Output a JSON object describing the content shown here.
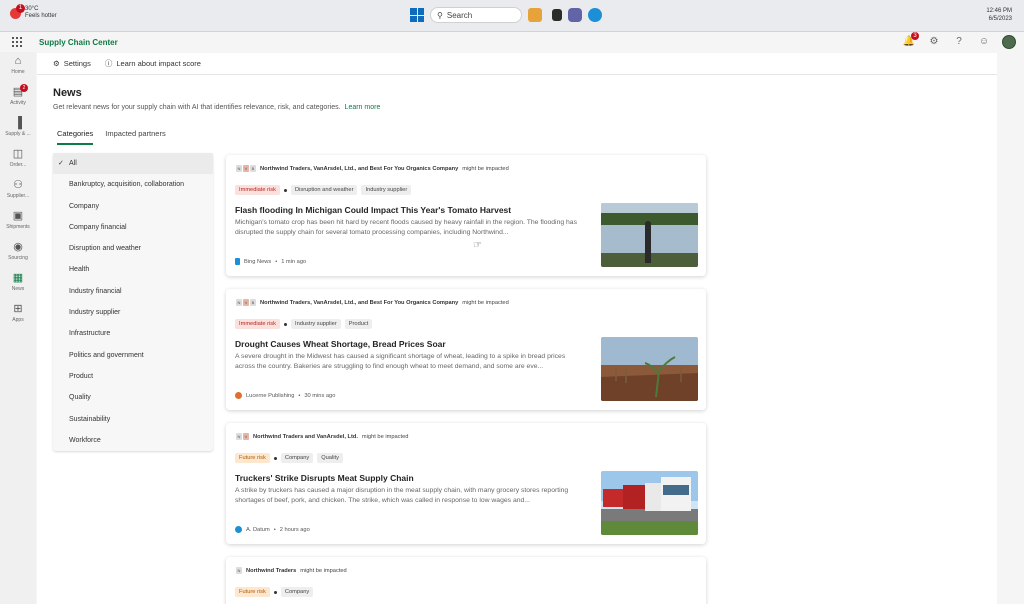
{
  "taskbar": {
    "weather_temp": "30°C",
    "weather_desc": "Feels hotter",
    "weather_badge": "1",
    "search_label": "Search",
    "time": "12:46 PM",
    "date": "6/5/2023"
  },
  "app": {
    "title": "Supply Chain Center",
    "notification_count": "3"
  },
  "rail": [
    {
      "label": "Home",
      "icon": "home-icon",
      "badge": ""
    },
    {
      "label": "Activity",
      "icon": "activity-icon",
      "badge": "2"
    },
    {
      "label": "Supply & ...",
      "icon": "supply-icon",
      "badge": ""
    },
    {
      "label": "Order...",
      "icon": "order-icon",
      "badge": ""
    },
    {
      "label": "Supplier...",
      "icon": "supplier-icon",
      "badge": ""
    },
    {
      "label": "Shipments",
      "icon": "shipments-icon",
      "badge": ""
    },
    {
      "label": "Sourcing",
      "icon": "sourcing-icon",
      "badge": ""
    },
    {
      "label": "News",
      "icon": "news-icon",
      "badge": ""
    },
    {
      "label": "Apps",
      "icon": "apps-icon",
      "badge": ""
    }
  ],
  "toolbar": {
    "settings_label": "Settings",
    "learn_label": "Learn about impact score"
  },
  "page": {
    "title": "News",
    "description": "Get relevant news for your supply chain with AI that identifies relevance, risk, and categories.",
    "learn_more": "Learn more"
  },
  "tabs": [
    {
      "label": "Categories",
      "active": true
    },
    {
      "label": "Impacted partners",
      "active": false
    }
  ],
  "categories": [
    "All",
    "Bankruptcy, acquisition, collaboration",
    "Company",
    "Company financial",
    "Disruption and weather",
    "Health",
    "Industry financial",
    "Industry supplier",
    "Infrastructure",
    "Politics and government",
    "Product",
    "Quality",
    "Sustainability",
    "Workforce"
  ],
  "articles": [
    {
      "partners": "Northwind Traders, VanArsdel, Ltd., and Best For You Organics Company",
      "impact_suffix": "might be impacted",
      "risk": "Immediate risk",
      "tags": [
        "Disruption and weather",
        "Industry supplier"
      ],
      "headline": "Flash flooding In Michigan Could Impact This Year's Tomato Harvest",
      "summary": "Michigan's tomato crop has been hit hard by recent floods caused by heavy rainfall in the region. The flooding has disrupted the supply chain for several tomato processing companies, including Northwind...",
      "source": "Bing News",
      "time": "1 min ago"
    },
    {
      "partners": "Northwind Traders, VanArsdel, Ltd., and Best For You Organics Company",
      "impact_suffix": "might be impacted",
      "risk": "Immediate risk",
      "tags": [
        "Industry supplier",
        "Product"
      ],
      "headline": "Drought Causes Wheat Shortage, Bread Prices Soar",
      "summary": "A severe drought in the Midwest has caused a significant shortage of wheat, leading to a spike in bread prices across the country. Bakeries are struggling to find enough wheat to meet demand, and some are eve...",
      "source": "Lucerne Publishing",
      "time": "30 mins ago"
    },
    {
      "partners": "Northwind Traders and VanArsdel, Ltd.",
      "impact_suffix": "might be impacted",
      "risk": "Future risk",
      "tags": [
        "Company",
        "Quality"
      ],
      "headline": "Truckers' Strike Disrupts Meat Supply Chain",
      "summary": "A strike by truckers has caused a major disruption in the meat supply chain, with many grocery stores reporting shortages of beef, pork, and chicken. The strike, which was called in response to low wages and...",
      "source": "A. Datum",
      "time": "2 hours ago"
    },
    {
      "partners": "Northwind Traders",
      "impact_suffix": "might be impacted",
      "risk": "Future risk",
      "tags": [
        "Company"
      ],
      "headline": "",
      "summary": "",
      "source": "",
      "time": ""
    }
  ],
  "colors": {
    "accent": "#0e7a45",
    "immediate_risk": "#b3261e",
    "future_risk": "#b45b00"
  }
}
